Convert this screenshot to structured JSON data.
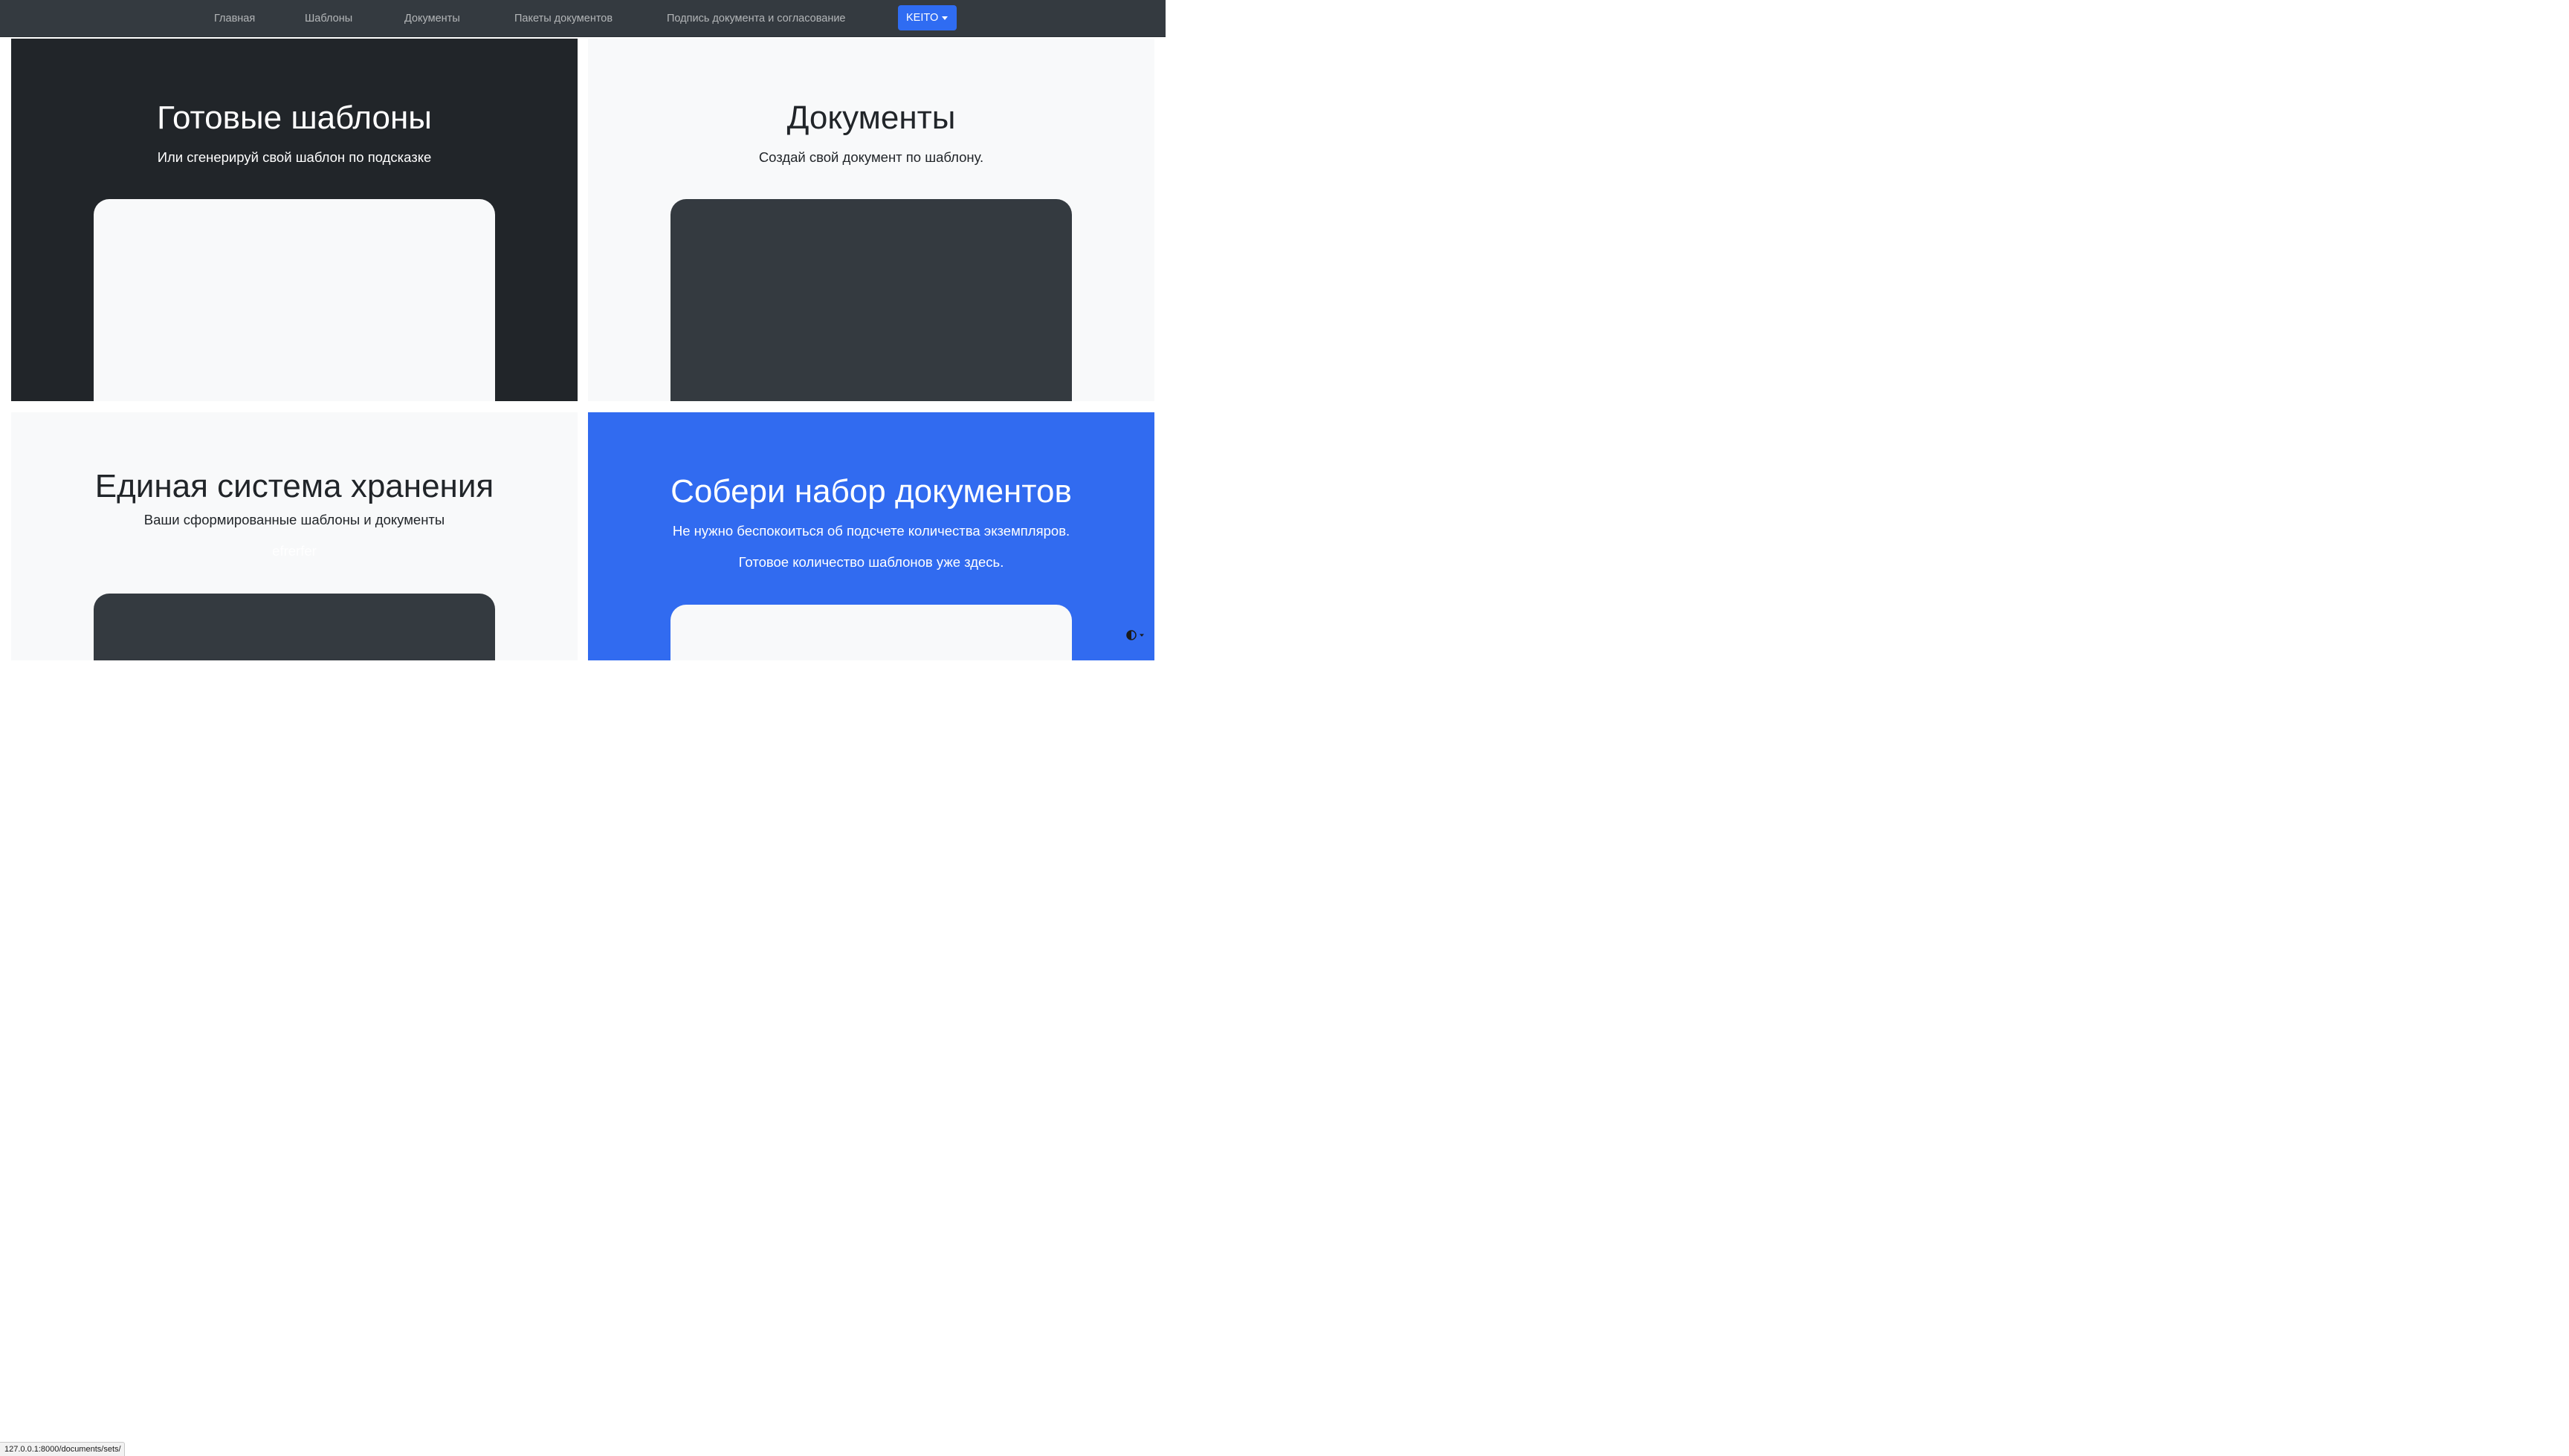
{
  "nav": {
    "links": [
      "Главная",
      "Шаблоны",
      "Документы",
      "Пакеты документов",
      "Подпись документа и согласование"
    ],
    "user_label": "KEITO"
  },
  "panels": {
    "templates": {
      "title": "Готовые шаблоны",
      "lead": "Или сгенерируй свой шаблон по подсказке"
    },
    "documents": {
      "title": "Документы",
      "lead": "Создай свой документ по шаблону."
    },
    "storage": {
      "title": "Единая система хранения",
      "lead": "Ваши сформированные шаблоны и документы",
      "faint": "efrerfer"
    },
    "sets": {
      "title": "Собери набор документов",
      "lead": "Не нужно беспокоиться об подсчете количества экземпляров.",
      "lead2": "Готовое количество шаблонов уже здесь."
    }
  },
  "status_url": "127.0.0.1:8000/documents/sets/",
  "colors": {
    "navbar": "#343a40",
    "dark_panel": "#212529",
    "light_panel": "#f8f9fa",
    "blue_panel": "#316bf0",
    "dark_box": "#343a40",
    "primary_button": "#2f6cf2"
  },
  "icons": {
    "dropdown": "caret-down-icon",
    "theme": "contrast-half-circle-icon"
  }
}
